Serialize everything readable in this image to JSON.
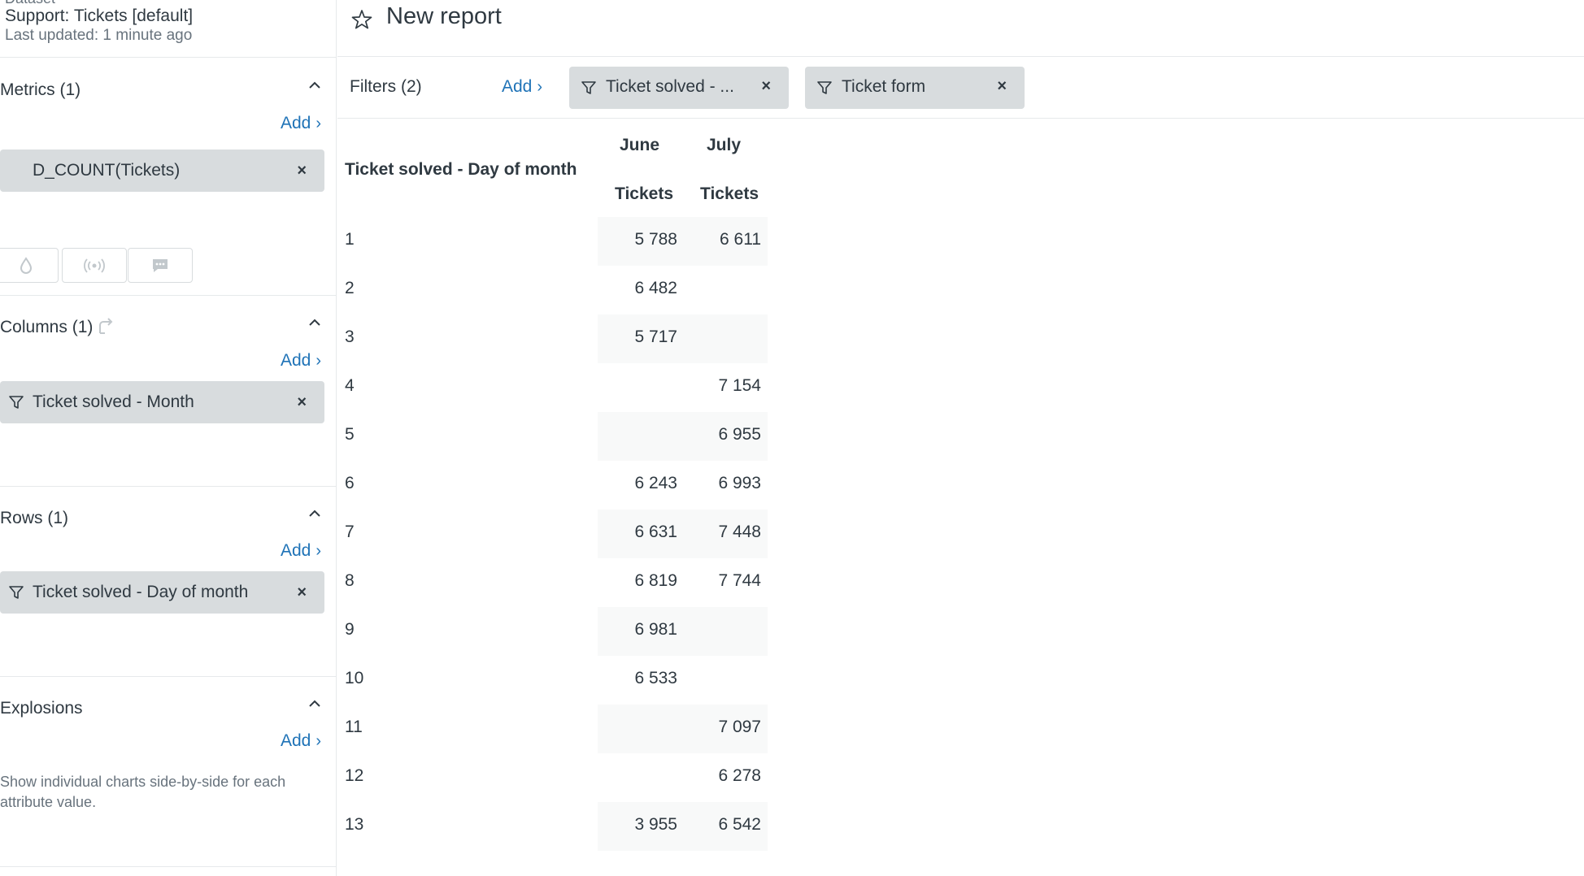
{
  "dataset": {
    "label_partial": "Dataset",
    "name": "Support: Tickets [default]",
    "updated": "Last updated: 1 minute ago"
  },
  "sidebar": {
    "metrics": {
      "title": "Metrics (1)",
      "add": "Add",
      "items": [
        {
          "label": "D_COUNT(Tickets)"
        }
      ]
    },
    "columns": {
      "title": "Columns (1)",
      "add": "Add",
      "items": [
        {
          "label": "Ticket solved - Month"
        }
      ]
    },
    "rows": {
      "title": "Rows (1)",
      "add": "Add",
      "items": [
        {
          "label": "Ticket solved - Day of month"
        }
      ]
    },
    "explosions": {
      "title": "Explosions",
      "add": "Add",
      "description": "Show individual charts side-by-side for each attribute value."
    },
    "metric_options": [
      "drop-icon",
      "broadcast-icon",
      "comment-icon"
    ],
    "remove_symbol": "×"
  },
  "report": {
    "title": "New report"
  },
  "filters": {
    "label": "Filters (2)",
    "add": "Add",
    "items": [
      {
        "label": "Ticket solved - ..."
      },
      {
        "label": "Ticket form"
      }
    ]
  },
  "table": {
    "row_header": "Ticket solved - Day of month",
    "col_groups": [
      "June",
      "July"
    ],
    "metric_header": "Tickets",
    "rows": [
      {
        "day": "1",
        "june": "5 788",
        "july": "6 611"
      },
      {
        "day": "2",
        "june": "6 482",
        "july": ""
      },
      {
        "day": "3",
        "june": "5 717",
        "july": ""
      },
      {
        "day": "4",
        "june": "",
        "july": "7 154"
      },
      {
        "day": "5",
        "june": "",
        "july": "6 955"
      },
      {
        "day": "6",
        "june": "6 243",
        "july": "6 993"
      },
      {
        "day": "7",
        "june": "6 631",
        "july": "7 448"
      },
      {
        "day": "8",
        "june": "6 819",
        "july": "7 744"
      },
      {
        "day": "9",
        "june": "6 981",
        "july": ""
      },
      {
        "day": "10",
        "june": "6 533",
        "july": ""
      },
      {
        "day": "11",
        "june": "",
        "july": "7 097"
      },
      {
        "day": "12",
        "june": "",
        "july": "6 278"
      },
      {
        "day": "13",
        "june": "3 955",
        "july": "6 542"
      }
    ]
  },
  "colors": {
    "accent": "#1f73b7",
    "pill": "#d8dcde",
    "text": "#2f3941",
    "muted": "#68737d",
    "stripe": "#f8f9f9"
  }
}
